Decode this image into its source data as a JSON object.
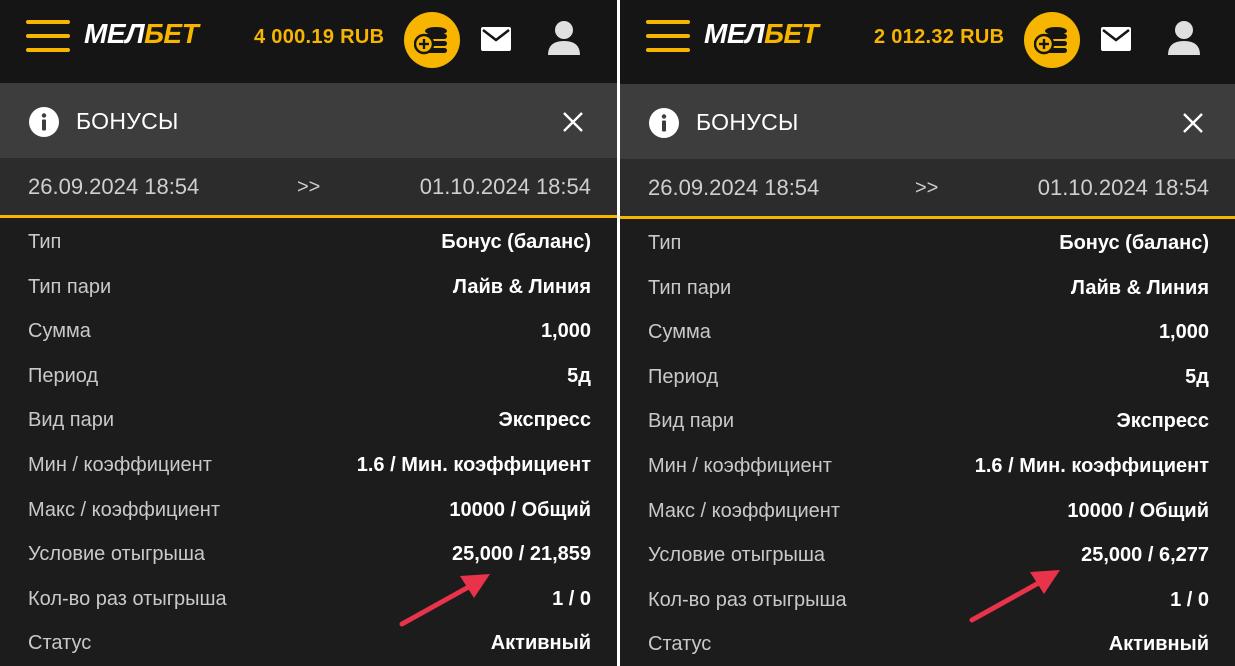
{
  "colors": {
    "accent": "#f7b500",
    "panel_bg": "#1c1c1c",
    "header_bg": "#3d3d3d",
    "arrow": "#e8334a"
  },
  "screens": [
    {
      "logo": {
        "part1": "МЕЛ",
        "part2": "БЕТ"
      },
      "balance": "4 000.19 RUB",
      "section_title": "БОНУСЫ",
      "date_start": "26.09.2024 18:54",
      "date_separator": ">>",
      "date_end": "01.10.2024 18:54",
      "rows": [
        {
          "label": "Тип",
          "value": "Бонус (баланс)"
        },
        {
          "label": "Тип пари",
          "value": "Лайв & Линия"
        },
        {
          "label": "Сумма",
          "value": "1,000"
        },
        {
          "label": "Период",
          "value": "5д"
        },
        {
          "label": "Вид пари",
          "value": "Экспресс"
        },
        {
          "label": "Мин / коэффициент",
          "value": "1.6 / Мин. коэффициент"
        },
        {
          "label": "Макс / коэффициент",
          "value": "10000 / Общий"
        },
        {
          "label": "Условие отыгрыша",
          "value": "25,000 / 21,859"
        },
        {
          "label": "Кол-во раз отыгрыша",
          "value": "1 / 0"
        },
        {
          "label": "Статус",
          "value": "Активный"
        }
      ]
    },
    {
      "logo": {
        "part1": "МЕЛ",
        "part2": "БЕТ"
      },
      "balance": "2 012.32 RUB",
      "section_title": "БОНУСЫ",
      "date_start": "26.09.2024 18:54",
      "date_separator": ">>",
      "date_end": "01.10.2024 18:54",
      "rows": [
        {
          "label": "Тип",
          "value": "Бонус (баланс)"
        },
        {
          "label": "Тип пари",
          "value": "Лайв & Линия"
        },
        {
          "label": "Сумма",
          "value": "1,000"
        },
        {
          "label": "Период",
          "value": "5д"
        },
        {
          "label": "Вид пари",
          "value": "Экспресс"
        },
        {
          "label": "Мин / коэффициент",
          "value": "1.6 / Мин. коэффициент"
        },
        {
          "label": "Макс / коэффициент",
          "value": "10000 / Общий"
        },
        {
          "label": "Условие отыгрыша",
          "value": "25,000 / 6,277"
        },
        {
          "label": "Кол-во раз отыгрыша",
          "value": "1 / 0"
        },
        {
          "label": "Статус",
          "value": "Активный"
        }
      ]
    }
  ],
  "icons": [
    "menu-icon",
    "coins-plus-icon",
    "mail-icon",
    "user-icon",
    "info-icon",
    "close-icon",
    "red-arrow-icon"
  ]
}
